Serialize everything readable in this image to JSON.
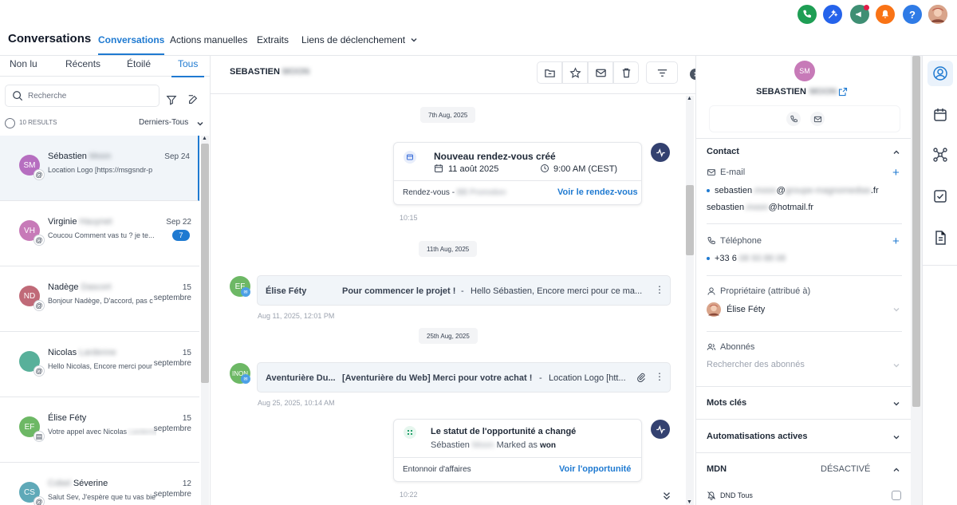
{
  "header": {
    "title": "Conversations",
    "tabs": [
      "Conversations",
      "Actions manuelles",
      "Extraits",
      "Liens de déclenchement"
    ]
  },
  "colors": {
    "accent": "#1f7ad1",
    "phone": "#1e9e54",
    "magic": "#2563eb",
    "megaphone": "#3f8f74",
    "bell": "#f97316",
    "help": "#2f7be6"
  },
  "left": {
    "tabs": [
      "Non lu",
      "Récents",
      "Étoilé",
      "Tous"
    ],
    "search_placeholder": "Recherche",
    "results": "10 RESULTS",
    "sort": "Derniers-Tous",
    "conversations": [
      {
        "initials": "SM",
        "first": "Sébastien",
        "last": "Moon",
        "date": "Sep 24",
        "preview": "Location Logo [https://msgsndr-p",
        "color": "#b66ec0",
        "channel": "@"
      },
      {
        "initials": "VH",
        "first": "Virginie",
        "last": "Hauynet",
        "date": "Sep 22",
        "preview": "Coucou  Comment vas tu ? je te...",
        "color": "#c77ab8",
        "channel": "@",
        "count": "7"
      },
      {
        "initials": "ND",
        "first": "Nadège",
        "last": "Dascort",
        "date": "15 septembre",
        "preview": "Bonjour Nadège,  D'accord, pas c",
        "color": "#c06a78",
        "channel": "@"
      },
      {
        "initials": "",
        "first": "Nicolas",
        "last": "Lardenne",
        "date": "15 septembre",
        "preview": "Hello Nicolas,  Encore merci pour",
        "color": "#58b09a",
        "channel": "@"
      },
      {
        "initials": "EF",
        "first": "Élise Féty",
        "last": "",
        "date": "15 septembre",
        "preview": "Votre appel avec Nicolas",
        "preview_blur": "Lardenne",
        "color": "#6db865",
        "channel": "▤"
      },
      {
        "initials": "CS",
        "first": "Séverine",
        "first_blur": "Cobel",
        "last": "",
        "date": "12 septembre",
        "preview": "Salut Sev, J'espère que tu vas bie",
        "color": "#5fa9b8",
        "channel": "@"
      }
    ]
  },
  "middle": {
    "contact_first": "SEBASTIEN",
    "contact_last": "MOON",
    "dates": [
      "7th Aug, 2025",
      "11th Aug, 2025",
      "25th Aug, 2025"
    ],
    "appointment": {
      "title": "Nouveau rendez-vous créé",
      "date": "11 août 2025",
      "time": "9:00 AM (CEST)",
      "type_label": "Rendez-vous -",
      "type_blur": "BB Promotion",
      "link": "Voir le rendez-vous",
      "timestamp": "10:15"
    },
    "message1": {
      "initials": "EF",
      "sender": "Élise Féty",
      "subject": "Pour commencer le projet !",
      "sep": "-",
      "snippet": "Hello Sébastien, Encore merci pour ce ma...",
      "timestamp": "Aug 11, 2025, 12:01 PM"
    },
    "message2": {
      "initials": "INON",
      "sender": "Aventurière Du...",
      "subject": "[Aventurière du Web] Merci pour votre achat !",
      "sep": "-",
      "snippet": "Location Logo [htt...",
      "timestamp": "Aug 25, 2025, 10:14 AM"
    },
    "opportunity": {
      "title": "Le statut de l'opportunité a changé",
      "name": "Sébastien",
      "name_blur": "Moon",
      "status_prefix": "Marked as",
      "status": "won",
      "pipeline": "Entonnoir d'affaires",
      "link": "Voir l'opportunité",
      "timestamp": "10:22"
    }
  },
  "right": {
    "initials": "SM",
    "name_first": "SEBASTIEN",
    "name_last": "MOON",
    "contact_title": "Contact",
    "email_label": "E-mail",
    "email1_prefix": "sebastien",
    "email1_blur": ".moon",
    "email1_at": "@",
    "email1_domain_blur": "groupe-magnomedias",
    "email1_suffix": ".fr",
    "email2_prefix": "sebastien",
    "email2_blur": ".moon",
    "email2_suffix": "@hotmail.fr",
    "phone_label": "Téléphone",
    "phone_prefix": "+33 6",
    "phone_blur": "08 93 88 08",
    "owner_label": "Propriétaire (attribué à)",
    "owner": "Élise Féty",
    "followers_label": "Abonnés",
    "followers_placeholder": "Rechercher des abonnés",
    "tags_title": "Mots clés",
    "automations_title": "Automatisations actives",
    "mdn_title": "MDN",
    "mdn_status": "DÉSACTIVÉ",
    "dnd_label": "DND Tous"
  }
}
